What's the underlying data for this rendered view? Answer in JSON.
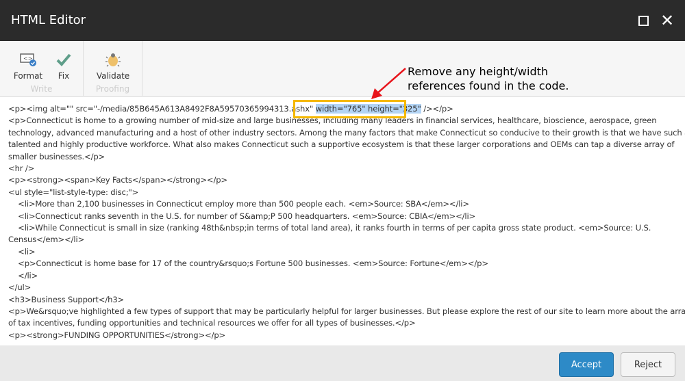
{
  "window": {
    "title": "HTML Editor"
  },
  "toolbar": {
    "groups": [
      {
        "label": "Write",
        "buttons": [
          {
            "label": "Format",
            "icon": "format-code-icon"
          },
          {
            "label": "Fix",
            "icon": "checkmark-icon"
          }
        ]
      },
      {
        "label": "Proofing",
        "buttons": [
          {
            "label": "Validate",
            "icon": "bug-icon"
          }
        ]
      }
    ]
  },
  "editor": {
    "line1_pre": "<p><img alt=\"\" src=\"-/media/85B645A613A8492F8A59570365994313.ashx\" ",
    "line1_sel": "width=\"765\" height=\"325\"",
    "line1_post": " /></p>",
    "lines": [
      "<p>Connecticut is home to a growing number of mid-size and large businesses, including many leaders in financial services, healthcare, bioscience, aerospace, green",
      "technology, advanced manufacturing and a host of other industry sectors. Among the many factors that make Connecticut so conducive to their growth is that we have such a",
      "talented and highly productive workforce. What also makes Connecticut such a supportive ecosystem is that these larger corporations and OEMs can tap a diverse array of",
      "smaller businesses.</p>",
      "<hr />",
      "<p><strong><span>Key Facts</span></strong></p>",
      "<ul style=\"list-style-type: disc;\">",
      "    <li>More than 2,100 businesses in Connecticut employ more than 500 people each. <em>Source: SBA</em></li>",
      "    <li>Connecticut ranks seventh in the U.S. for number of S&amp;P 500 headquarters. <em>Source: CBIA</em></li>",
      "    <li>While Connecticut is small in size (ranking 48th&nbsp;in terms of total land area), it ranks fourth in terms of per capita gross state product. <em>Source: U.S.",
      "Census</em></li>",
      "    <li>",
      "    <p>Connecticut is home base for 17 of the country&rsquo;s Fortune 500 businesses. <em>Source: Fortune</em></p>",
      "    </li>",
      "</ul>",
      "<h3>Business Support</h3>",
      "<p>We&rsquo;ve highlighted a few types of support that may be particularly helpful for larger businesses. But please explore the rest of our site to learn more about the array",
      "of tax incentives, funding opportunities and technical resources we offer for all types of businesses.</p>",
      "<p><strong>FUNDING OPPORTUNITIES</strong></p>"
    ]
  },
  "annotation": {
    "line1": "Remove any height/width",
    "line2": "references found in the code.",
    "highlight_color": "#f5b800",
    "arrow_color": "#e8141b"
  },
  "footer": {
    "accept": "Accept",
    "reject": "Reject"
  }
}
